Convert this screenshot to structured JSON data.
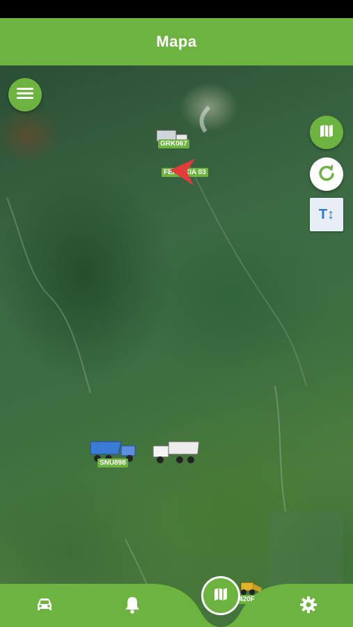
{
  "header": {
    "title": "Mapa"
  },
  "vehicles": [
    {
      "label": "GRK067"
    },
    {
      "label": "FERRICIA 03"
    },
    {
      "label": "SNU898"
    },
    {
      "label": "420F"
    }
  ],
  "controls": {
    "text_toggle": "T↕"
  },
  "colors": {
    "primary": "#6db33f",
    "accent_blue": "#2a78d6",
    "marker_red": "#e23b3b"
  },
  "icons": {
    "menu": "hamburger-icon",
    "map_type": "map-icon",
    "refresh": "refresh-icon",
    "nav_vehicles": "car-icon",
    "nav_alerts": "bell-icon",
    "nav_map": "map-icon",
    "nav_settings": "gear-icon"
  }
}
